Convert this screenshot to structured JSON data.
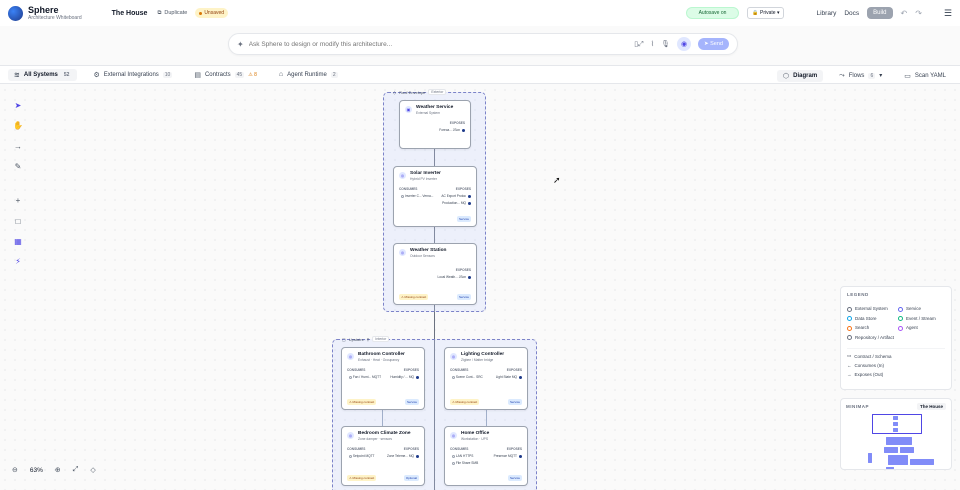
{
  "header": {
    "app_name": "Sphere",
    "app_subtitle": "Architecture Whiteboard",
    "project": "The House",
    "duplicate_label": "Duplicate",
    "unsaved_label": "Unsaved",
    "autosave_label": "Autosave on",
    "visibility_label": "Private",
    "nav": [
      "Library",
      "Docs"
    ],
    "build_label": "Build"
  },
  "prompt": {
    "placeholder": "Ask Sphere to design or modify this architecture...",
    "send_label": "Send"
  },
  "tabs": [
    {
      "label": "All Systems",
      "count": "52",
      "icon": "layers-icon"
    },
    {
      "label": "External Integrations",
      "count": "10",
      "icon": "plug-icon"
    },
    {
      "label": "Contracts",
      "count": "45",
      "warn": "8",
      "icon": "contract-icon"
    },
    {
      "label": "Agent Runtime",
      "count": "2",
      "icon": "robot-icon"
    }
  ],
  "tabs_right": {
    "diagram": "Diagram",
    "flows": "Flows",
    "flows_count": "6",
    "scan": "Scan YAML"
  },
  "zoom": {
    "level": "63%"
  },
  "groups": {
    "roof": {
      "name": "Roof Envelope",
      "badge": "Exterior"
    },
    "upstairs": {
      "name": "Upstairs",
      "badge": "Interior"
    }
  },
  "nodes": {
    "weather_service": {
      "title": "Weather Service",
      "sub": "External System",
      "exposes": "EXPOSES",
      "row_right": "Foreca... JSon"
    },
    "solar": {
      "title": "Solar Inverter",
      "sub": "Hybrid PV Inverter",
      "consumes": "CONSUMES",
      "exposes": "EXPOSES",
      "row1_left": "Inverter C... Verna...",
      "row1_right": "AC Export Protoc",
      "row2_right": "Production... MQ",
      "kind": "Service"
    },
    "weather_station": {
      "title": "Weather Station",
      "sub": "Outdoor Sensors",
      "exposes": "EXPOSES",
      "row_right": "Local Weath... JSon",
      "missing": "Missing contract",
      "kind": "Service"
    },
    "bathroom": {
      "title": "Bathroom Controller",
      "sub": "Exhaust · Heat · Occupancy",
      "consumes": "CONSUMES",
      "exposes": "EXPOSES",
      "row_left": "Fan / Humi... MQTT",
      "row_right": "Humidity / ... MQ",
      "missing": "Missing contract",
      "kind": "Service"
    },
    "lighting": {
      "title": "Lighting Controller",
      "sub": "Zigbee / Matter bridge",
      "consumes": "CONSUMES",
      "exposes": "EXPOSES",
      "row_left": "Scene Cont... SRC",
      "row_right": "Light State MQ",
      "missing": "Missing contract",
      "kind": "Service"
    },
    "bedroom": {
      "title": "Bedroom Climate Zone",
      "sub": "Zone damper · sensors",
      "consumes": "CONSUMES",
      "exposes": "EXPOSES",
      "row_left": "Setpoint MQTT",
      "row_right": "Zone Teleme... MQ",
      "missing": "Missing contract",
      "kind": "Optional"
    },
    "office": {
      "title": "Home Office",
      "sub": "Workstation · UPS",
      "consumes": "CONSUMES",
      "exposes": "EXPOSES",
      "row1_left": "LAN HTTPS",
      "row1_right": "Presence MQTT",
      "row2_left": "File Share SMB",
      "kind": "Service"
    }
  },
  "legend": {
    "title": "LEGEND",
    "items": [
      {
        "label": "External System",
        "color": "#6b7280"
      },
      {
        "label": "Service",
        "color": "#6366f1"
      },
      {
        "label": "Data Store",
        "color": "#0ea5e9"
      },
      {
        "label": "Event / Stream",
        "color": "#10b981"
      },
      {
        "label": "Search",
        "color": "#f97316"
      },
      {
        "label": "Agent",
        "color": "#a855f7"
      },
      {
        "label": "Repository / Artifact",
        "color": "#6b7280"
      }
    ],
    "lines": [
      "Contract / Schema",
      "Consumes (In)",
      "Exposes (Out)"
    ]
  },
  "minimap": {
    "title": "MINIMAP",
    "project": "The House"
  }
}
